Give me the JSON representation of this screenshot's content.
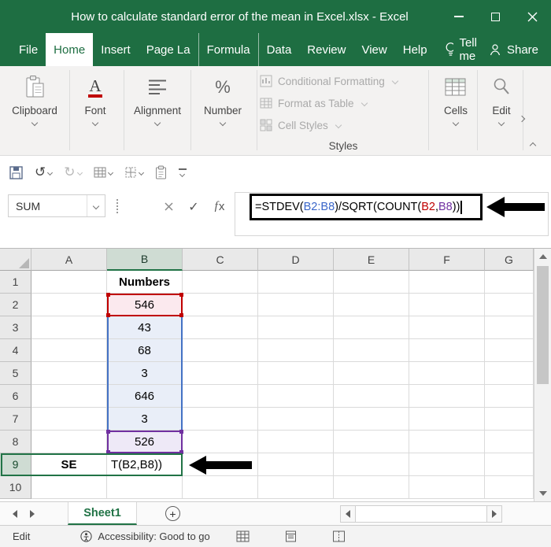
{
  "theme": {
    "excel_green": "#217346",
    "titlebar_green": "#1e6e42",
    "ref_blue": "#4472c4",
    "ref_red": "#c00000",
    "ref_purple": "#7030a0"
  },
  "window": {
    "title": "How to calculate standard error of the mean in Excel.xlsx - Excel"
  },
  "menu": {
    "tabs": [
      "File",
      "Home",
      "Insert",
      "Page La",
      "Formula",
      "Data",
      "Review",
      "View",
      "Help"
    ],
    "tell_me": "Tell me",
    "share": "Share"
  },
  "ribbon": {
    "groups": [
      "Clipboard",
      "Font",
      "Alignment",
      "Number"
    ],
    "styles_items": [
      "Conditional Formatting",
      "Format as Table",
      "Cell Styles"
    ],
    "styles_label": "Styles",
    "cells_label": "Cells",
    "edit_label": "Edit"
  },
  "formula": {
    "name_box": "SUM",
    "parts": [
      {
        "text": "=STDEV("
      },
      {
        "text": "B2:B8"
      },
      {
        "text": ")/SQRT(COUNT("
      },
      {
        "text": "B2"
      },
      {
        "text": ","
      },
      {
        "text": "B8"
      },
      {
        "text": "))"
      }
    ]
  },
  "grid": {
    "columns": [
      "A",
      "B",
      "C",
      "D",
      "E",
      "F",
      "G"
    ],
    "rows": [
      "1",
      "2",
      "3",
      "4",
      "5",
      "6",
      "7",
      "8",
      "9",
      "10"
    ],
    "cells": {
      "B1": "Numbers",
      "B2": "546",
      "B3": "43",
      "B4": "68",
      "B5": "3",
      "B6": "646",
      "B7": "3",
      "B8": "526",
      "A9": "SE",
      "B9": "T(B2,B8))"
    }
  },
  "sheets": {
    "active": "Sheet1"
  },
  "status": {
    "mode": "Edit",
    "accessibility": "Accessibility: Good to go"
  },
  "icons": {
    "undo": "↺",
    "redo": "↻",
    "check": "✓",
    "fx_sub": "x",
    "new_sheet": "+"
  }
}
